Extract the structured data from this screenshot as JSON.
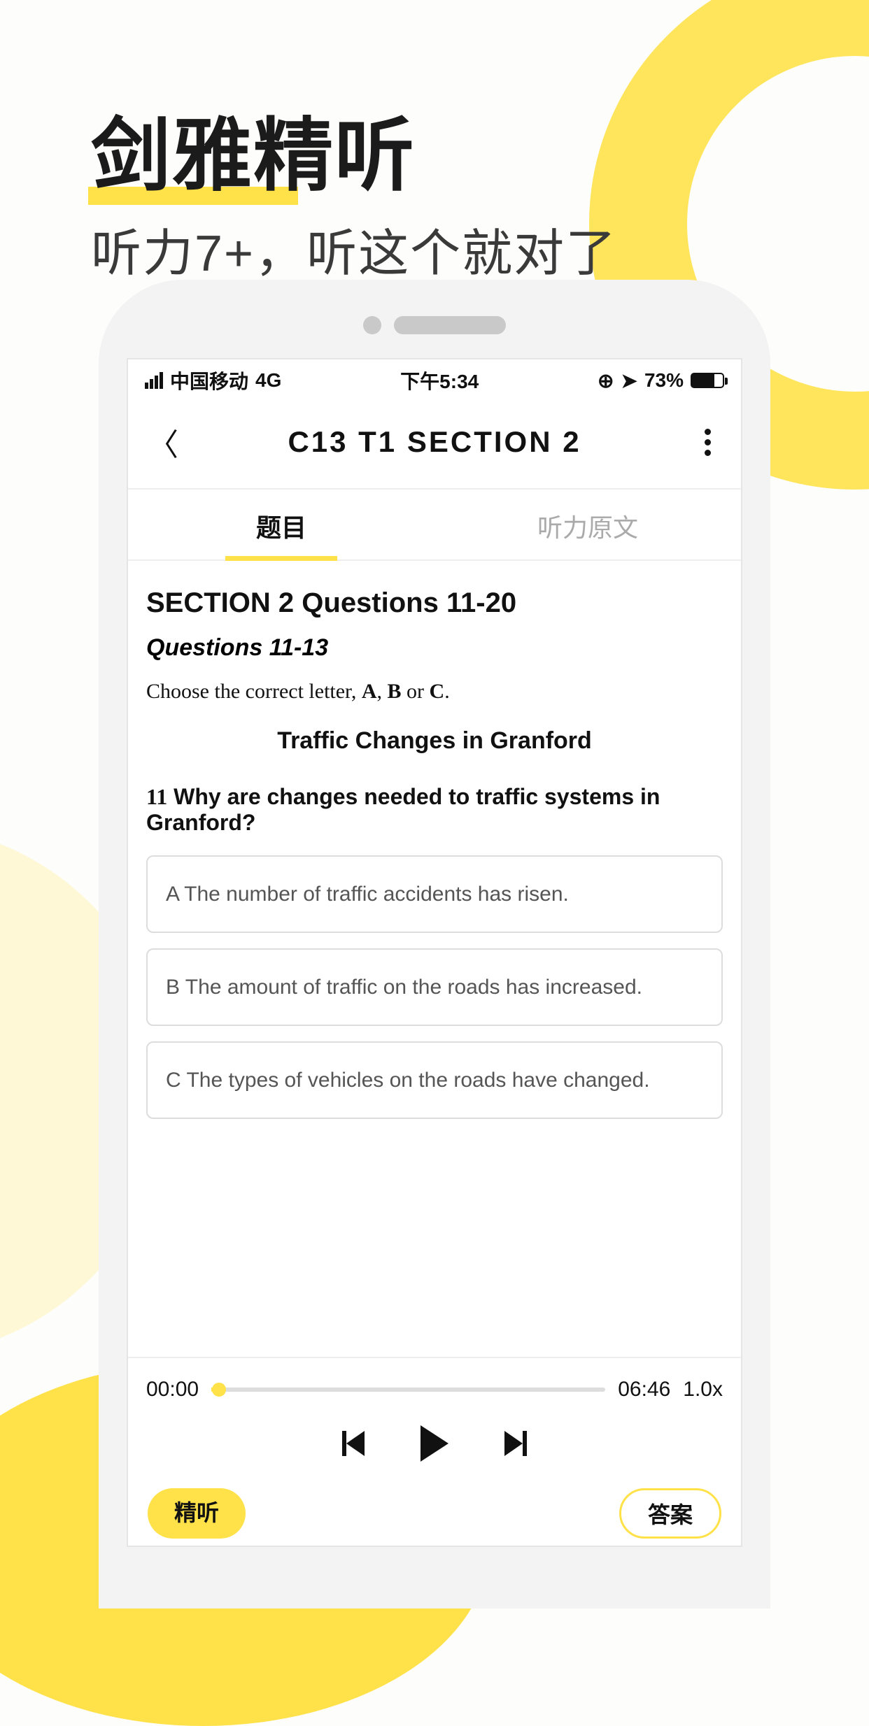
{
  "marketing": {
    "title": "剑雅精听",
    "subtitle": "听力7+，听这个就对了"
  },
  "status": {
    "carrier": "中国移动",
    "network": "4G",
    "time": "下午5:34",
    "battery_pct": "73%"
  },
  "nav": {
    "title": "C13  T1  SECTION 2"
  },
  "tabs": {
    "questions": "题目",
    "transcript": "听力原文"
  },
  "section": {
    "title": "SECTION 2 Questions 11-20",
    "subtitle": "Questions 11-13",
    "instruction_prefix": "Choose the correct letter, ",
    "instruction_a": "A",
    "instruction_sep1": ", ",
    "instruction_b": "B",
    "instruction_sep2": " or ",
    "instruction_c": "C",
    "instruction_suffix": ".",
    "topic": "Traffic Changes in Granford"
  },
  "q11": {
    "num": "11",
    "text": "Why are changes needed to traffic systems in Granford?",
    "choices": [
      "A The number of traffic accidents has risen.",
      "B The amount of traffic on the roads has increased.",
      "C The types of vehicles on the roads have changed."
    ]
  },
  "player": {
    "current": "00:00",
    "total": "06:46",
    "speed": "1.0x"
  },
  "bottom": {
    "intensive": "精听",
    "answer": "答案"
  }
}
